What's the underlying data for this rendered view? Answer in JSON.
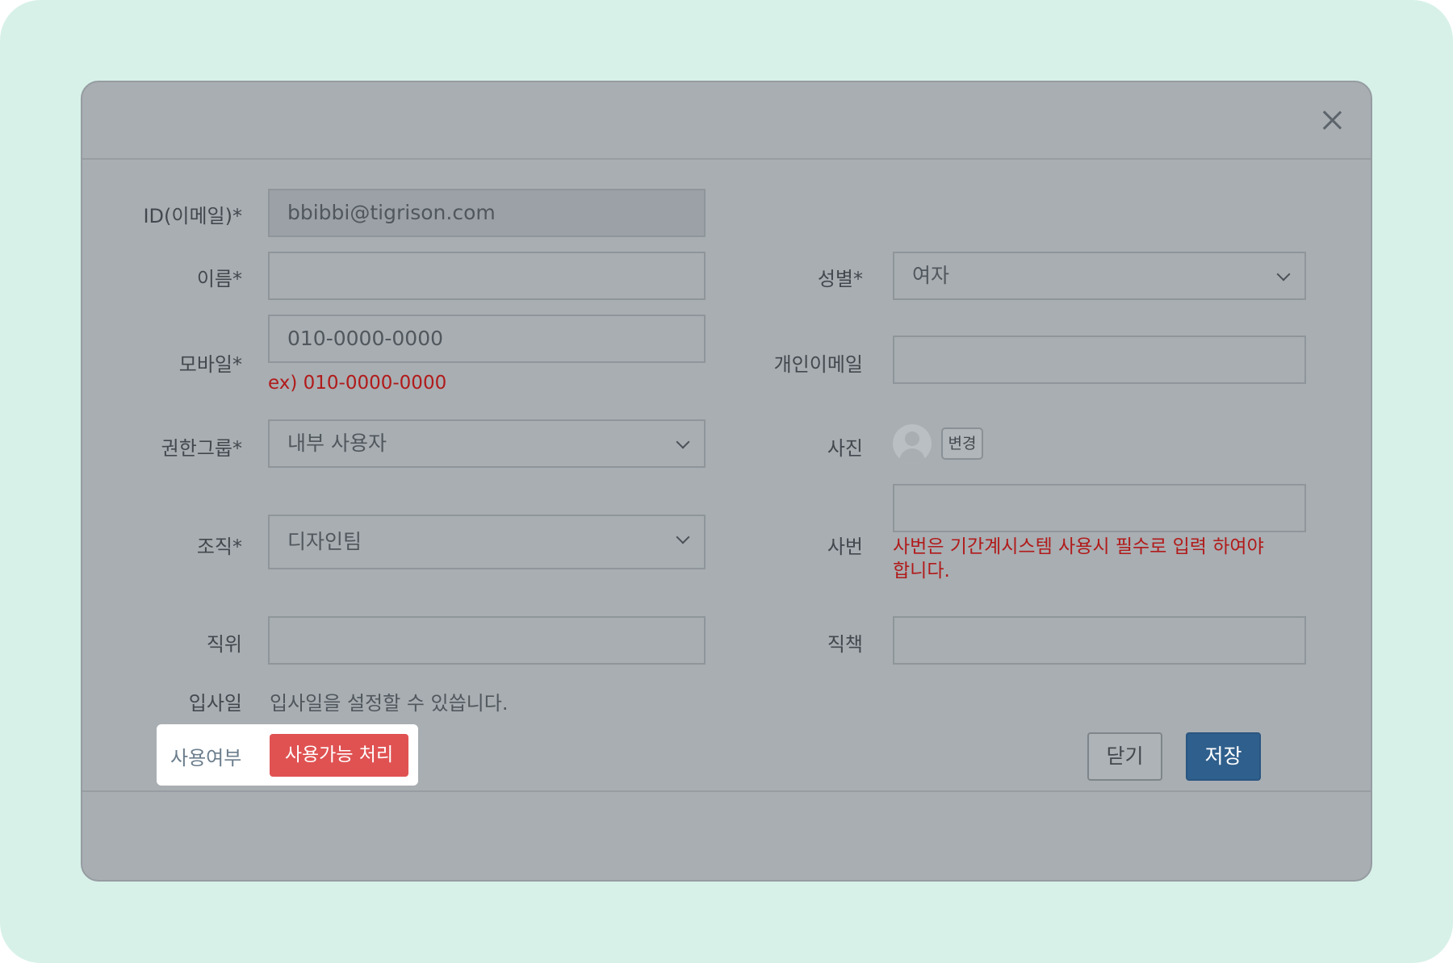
{
  "modal": {
    "close_icon": "close-icon"
  },
  "form": {
    "id_email": {
      "label": "ID(이메일)*",
      "value": "bbibbi@tigrison.com"
    },
    "name": {
      "label": "이름*",
      "value": ""
    },
    "gender": {
      "label": "성별*",
      "value": "여자"
    },
    "mobile": {
      "label": "모바일*",
      "value": "010-0000-0000",
      "hint": "ex) 010-0000-0000"
    },
    "personal_email": {
      "label": "개인이메일",
      "value": ""
    },
    "auth_group": {
      "label": "권한그룹*",
      "value": "내부 사용자"
    },
    "photo": {
      "label": "사진",
      "change_label": "변경",
      "avatar_icon": "user-avatar-icon"
    },
    "organization": {
      "label": "조직*",
      "value": "디자인팀"
    },
    "employee_no": {
      "label": "사번",
      "value": "",
      "hint": "사번은 기간계시스템 사용시 필수로 입력 하여야 합니다."
    },
    "position": {
      "label": "직위",
      "value": ""
    },
    "duty": {
      "label": "직책",
      "value": ""
    },
    "hire_date": {
      "label": "입사일",
      "text": "입사일을 설정할 수 있씁니다."
    },
    "usage": {
      "label": "사용여부",
      "button_label": "사용가능 처리"
    }
  },
  "footer": {
    "close_label": "닫기",
    "save_label": "저장"
  },
  "colors": {
    "background": "#d7f1e8",
    "overlay": "#a8aeb2",
    "danger": "#e05252",
    "primary": "#2f5f8c",
    "hint": "#b11a1a"
  }
}
